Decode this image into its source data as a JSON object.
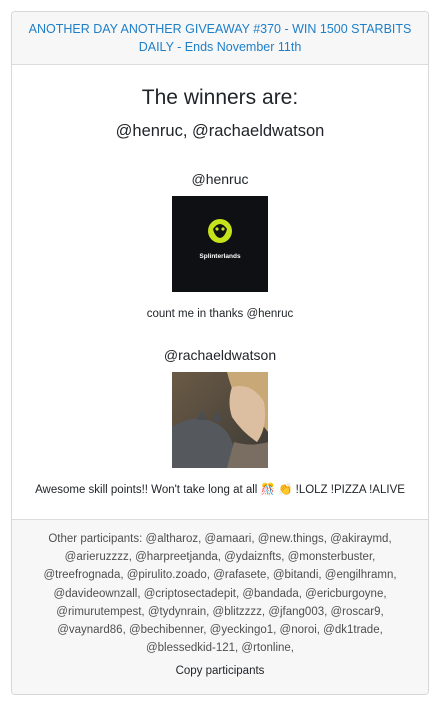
{
  "header": {
    "title": "ANOTHER DAY ANOTHER GIVEAWAY #370 - WIN 1500 STARBITS DAILY - Ends November 11th"
  },
  "winners": {
    "heading": "The winners are:",
    "list_text": "@henruc, @rachaeldwatson"
  },
  "entries": [
    {
      "user": "@henruc",
      "image_label": "Splinterlands",
      "comment": "count me in thanks @henruc"
    },
    {
      "user": "@rachaeldwatson",
      "image_label": "",
      "comment_prefix": "Awesome skill points!! Won't take long at all",
      "comment_suffix": "!LOLZ !PIZZA !ALIVE"
    }
  ],
  "footer": {
    "participants_text": "Other participants: @altharoz, @amaari, @new.things, @akiraymd, @arieruzzzz, @harpreetjanda, @ydaiznfts, @monsterbuster, @treefrognada, @pirulito.zoado, @rafasete, @bitandi, @engilhramn, @davideownzall, @criptosectadepit, @bandada, @ericburgoyne, @rimurutempest, @tydynrain, @blitzzzz, @jfang003, @roscar9, @vaynard86, @bechibenner, @yeckingo1, @noroi, @dk1trade, @blessedkid-121, @rtonline,",
    "copy_label": "Copy participants"
  },
  "colors": {
    "accent": "#1e7fc9",
    "splinterlands_green": "#c6e21a",
    "header_bg": "#f7f7f7"
  }
}
